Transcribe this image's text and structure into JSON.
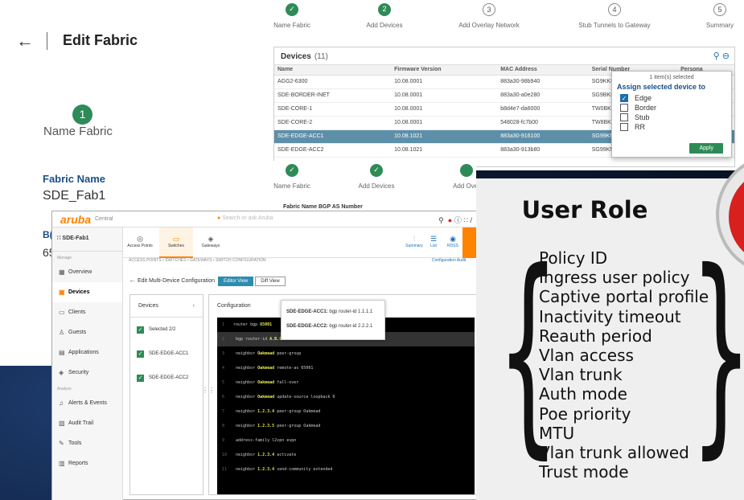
{
  "left_panel": {
    "back_icon": "arrow-left-icon",
    "title": "Edit Fabric",
    "step_number": "1",
    "step_label": "Name Fabric",
    "fabric_name_label": "Fabric Name",
    "fabric_name_value": "SDE_Fab1",
    "fragment_1": "B(",
    "fragment_2": "65"
  },
  "wizard": {
    "steps": [
      {
        "num": "✓",
        "label": "Name Fabric",
        "state": "done"
      },
      {
        "num": "2",
        "label": "Add Devices",
        "state": "done"
      },
      {
        "num": "3",
        "label": "Add Overlay Network",
        "state": "todo"
      },
      {
        "num": "4",
        "label": "Stub Tunnels to Gateway",
        "state": "todo"
      },
      {
        "num": "5",
        "label": "Summary",
        "state": "todo"
      }
    ]
  },
  "devices_table": {
    "title": "Devices",
    "count": "(11)",
    "columns": [
      "Name",
      "Firmware Version",
      "MAC Address",
      "Serial Number",
      "Persona"
    ],
    "rows": [
      [
        "AGG2-6300",
        "10.08.0001",
        "883a30-98b940",
        "SG9KKM008J",
        ""
      ],
      [
        "SDE-BORDER-INET",
        "10.08.0001",
        "883a30-a0e280",
        "SG9BKMX035",
        ""
      ],
      [
        "SDE-CORE-1",
        "10.08.0001",
        "b8d4e7-da6000",
        "TW0BKM005J",
        ""
      ],
      [
        "SDE-CORE-2",
        "10.08.0001",
        "548028-fc7b00",
        "TW8BKM0025",
        ""
      ],
      [
        "SDE-EDGE-ACC1",
        "10.08.1021",
        "883a30-916100",
        "SG99KN003F",
        ""
      ],
      [
        "SDE-EDGE-ACC2",
        "10.08.1021",
        "883a30-913b80",
        "SG99KN003D",
        ""
      ]
    ],
    "selected_row": 4
  },
  "assign_popup": {
    "selected_count": "1 item(s) selected",
    "title": "Assign selected device to",
    "options": [
      {
        "label": "Edge",
        "checked": true
      },
      {
        "label": "Border",
        "checked": false
      },
      {
        "label": "Stub",
        "checked": false
      },
      {
        "label": "RR",
        "checked": false
      }
    ],
    "apply_label": "Apply"
  },
  "wizard2": {
    "steps": [
      "Name Fabric",
      "Add Devices",
      "Add Over"
    ],
    "fabric_name_header": "Fabric Name    BGP AS Number"
  },
  "central": {
    "logo": "aruba",
    "product": "Central",
    "search_placeholder": "Search or ask Aruba",
    "fabric_selector": "SDE-Fab1",
    "groups": {
      "manage": "Manage",
      "analyze": "Analyze"
    },
    "sidebar_items": [
      {
        "label": "Overview",
        "icon": "overview-icon",
        "glyph": "▦"
      },
      {
        "label": "Devices",
        "icon": "devices-icon",
        "glyph": "▣"
      },
      {
        "label": "Clients",
        "icon": "clients-icon",
        "glyph": "▭"
      },
      {
        "label": "Guests",
        "icon": "guests-icon",
        "glyph": "♙"
      },
      {
        "label": "Applications",
        "icon": "applications-icon",
        "glyph": "▤"
      },
      {
        "label": "Security",
        "icon": "security-icon",
        "glyph": "◈"
      },
      {
        "label": "Alerts & Events",
        "icon": "alerts-icon",
        "glyph": "♫"
      },
      {
        "label": "Audit Trail",
        "icon": "audit-trail-icon",
        "glyph": "▧"
      },
      {
        "label": "Tools",
        "icon": "tools-icon",
        "glyph": "✎"
      },
      {
        "label": "Reports",
        "icon": "reports-icon",
        "glyph": "▥"
      }
    ],
    "device_tabs": [
      {
        "label": "Access Points",
        "icon": "access-point-icon",
        "glyph": "◎"
      },
      {
        "label": "Switches",
        "icon": "switch-icon",
        "glyph": "▭"
      },
      {
        "label": "Gateways",
        "icon": "gateway-icon",
        "glyph": "◈"
      }
    ],
    "right_tabs": [
      {
        "label": "Summary",
        "glyph": "⫶"
      },
      {
        "label": "List",
        "glyph": "☰"
      },
      {
        "label": "RDSS",
        "glyph": "◉"
      }
    ],
    "breadcrumbs": "ACCESS POINTS • SWITCHES • GATEWAYS • SWITCH CONFIGURATION",
    "config_link": "Configuration Audit",
    "edit_title": "Edit Multi-Device Configuration",
    "edit_view": "Editor View",
    "diff_view": "Diff View",
    "devices_header": "Devices",
    "device_rows": [
      "Selected 2/2",
      "SDE-EDGE-ACC1",
      "SDE-EDGE-ACC2"
    ],
    "config_header": "Configuration",
    "tooltip": [
      {
        "device": "SDE-EDGE-ACC1:",
        "cmd": "bgp router-id 1.1.1.1"
      },
      {
        "device": "SDE-EDGE-ACC2:",
        "cmd": "bgp router-id 2.2.2.1"
      }
    ],
    "code_lines": [
      {
        "ln": "1",
        "pre": "router bgp ",
        "hl": "65001",
        "post": ""
      },
      {
        "ln": "2",
        "pre": "  bgp router-id ",
        "hl": "A.B.C.D",
        "post": ""
      },
      {
        "ln": "3",
        "pre": "  neighbor ",
        "hl": "Oakmead",
        "post": " peer-group"
      },
      {
        "ln": "4",
        "pre": "  neighbor ",
        "hl": "Oakmead",
        "post": " remote-as 65001"
      },
      {
        "ln": "5",
        "pre": "  neighbor ",
        "hl": "Oakmead",
        "post": " fall-over"
      },
      {
        "ln": "6",
        "pre": "  neighbor ",
        "hl": "Oakmead",
        "post": " update-source loopback 0"
      },
      {
        "ln": "7",
        "pre": "  neighbor ",
        "hl": "1.2.3.4",
        "post": " peer-group Oakmead"
      },
      {
        "ln": "8",
        "pre": "  neighbor ",
        "hl": "1.2.3.5",
        "post": " peer-group Oakmead"
      },
      {
        "ln": "9",
        "pre": "  address-family l2vpn evpn",
        "hl": "",
        "post": ""
      },
      {
        "ln": "10",
        "pre": "      neighbor ",
        "hl": "1.2.3.4",
        "post": " activate"
      },
      {
        "ln": "11",
        "pre": "      neighbor ",
        "hl": "1.2.3.4",
        "post": " send-community extended"
      }
    ]
  },
  "user_role": {
    "title": "User Role",
    "items": [
      "Policy ID",
      "Ingress user policy",
      "Captive portal profile",
      "Inactivity timeout",
      "Reauth period",
      "Vlan access",
      "Vlan trunk",
      "Auth mode",
      "Poe priority",
      "MTU",
      "Vlan trunk allowed",
      "Trust mode"
    ]
  },
  "colors": {
    "accent_green": "#2e8b57",
    "aruba_orange": "#ff8300",
    "link_blue": "#1a6fb0",
    "selected_row": "#5e8fa8",
    "badge_red": "#d8201f"
  }
}
